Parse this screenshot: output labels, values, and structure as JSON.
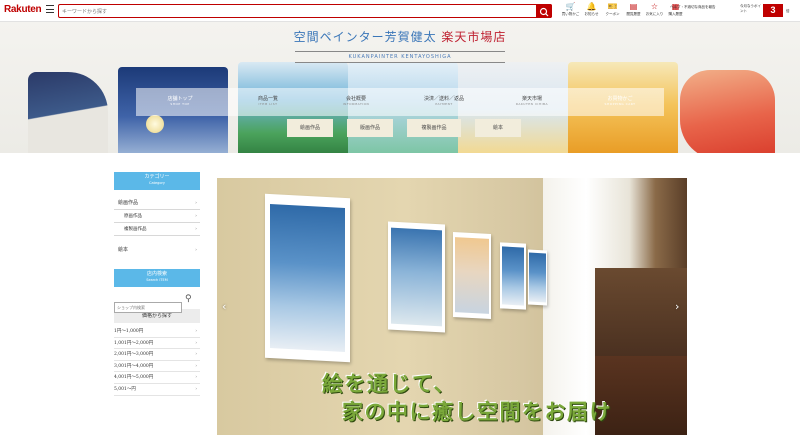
{
  "topbar": {
    "logo": "Rakuten",
    "search_placeholder": "キーワードから探す",
    "icons": [
      {
        "label": "買い物かご",
        "glyph": "🛒",
        "icon": "cart-icon"
      },
      {
        "label": "お知らせ",
        "glyph": "🔔",
        "icon": "bell-icon"
      },
      {
        "label": "クーポン",
        "glyph": "🎫",
        "icon": "coupon-icon"
      },
      {
        "label": "閲覧履歴",
        "glyph": "▤",
        "icon": "history-icon"
      },
      {
        "label": "お気に入り",
        "glyph": "☆",
        "icon": "star-icon"
      },
      {
        "label": "購入履歴",
        "glyph": "▦",
        "icon": "receipt-icon"
      }
    ],
    "help": "ヘルプ・不適切な商品を報告",
    "points_label": "今月なうポイント",
    "points_value": "3",
    "points_unit": "倍"
  },
  "banner": {
    "shop_name_blue": "空間ペインター芳賀健太",
    "shop_name_red": "楽天市場店",
    "shop_name_en": "KUKANPAINTER KENTAYOSHIGA",
    "nav": [
      {
        "label": "店舗トップ",
        "sub": "SHOP TOP"
      },
      {
        "label": "商品一覧",
        "sub": "ITEM LIST"
      },
      {
        "label": "会社概要",
        "sub": "INFORMATION"
      },
      {
        "label": "決済／送料／返品",
        "sub": "PAYMENT"
      },
      {
        "label": "楽天市場",
        "sub": "RAKUTEN ICHIBA"
      },
      {
        "label": "お買物かご",
        "sub": "SHOPPING CART"
      }
    ],
    "subnav": [
      "絵画作品",
      "版画作品",
      "複製画作品",
      "絵本"
    ]
  },
  "sidebar": {
    "category_title": "カテゴリー",
    "category_sub": "Category",
    "categories": [
      {
        "label": "絵画作品",
        "sub": false
      },
      {
        "label": "原画作品",
        "sub": true
      },
      {
        "label": "複製画作品",
        "sub": true
      },
      {
        "label": "絵本",
        "sub": false
      }
    ],
    "shop_search_title": "店内検索",
    "shop_search_sub": "Search ITEM",
    "shop_search_placeholder": "ショップ内検索",
    "price_title": "価格から探す",
    "prices": [
      "1円〜1,000円",
      "1,001円〜2,000円",
      "2,001円〜3,000円",
      "3,001円〜4,000円",
      "4,001円〜5,000円",
      "5,001〜円"
    ]
  },
  "hero": {
    "caption_line1": "絵を通じて、",
    "caption_line2": "家の中に癒し空間をお届け",
    "prev": "‹",
    "next": "›"
  },
  "colors": {
    "brand": "#bf0000",
    "accent": "#5bb8e8",
    "caption": "#7aa83a"
  }
}
